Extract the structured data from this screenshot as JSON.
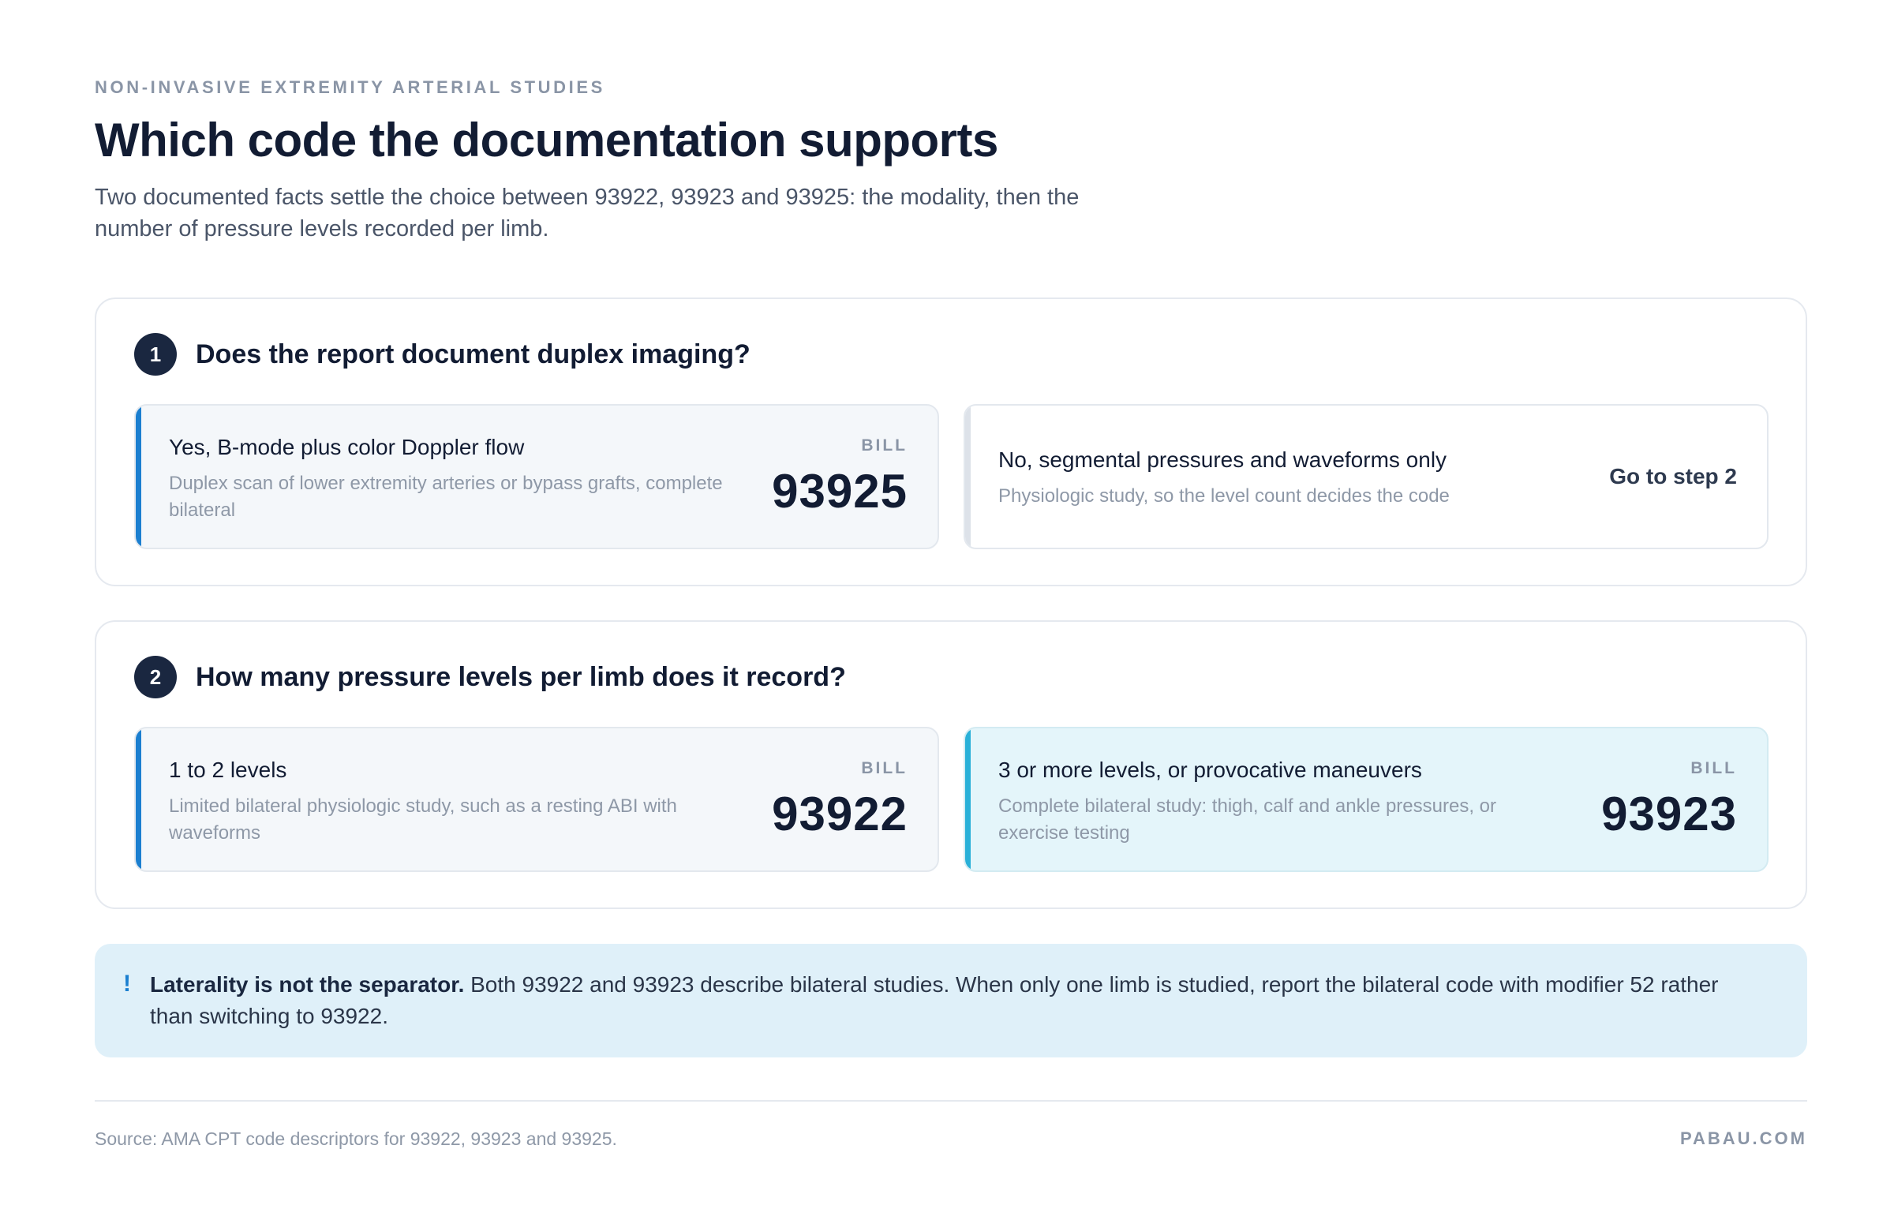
{
  "header": {
    "eyebrow": "NON-INVASIVE EXTREMITY ARTERIAL STUDIES",
    "title": "Which code the documentation supports",
    "subtitle": "Two documented facts settle the choice between 93922, 93923 and 93925: the modality, then the number of pressure levels recorded per limb."
  },
  "steps": [
    {
      "number": "1",
      "question": "Does the report document duplex imaging?",
      "options": [
        {
          "title": "Yes, B-mode plus color Doppler flow",
          "description": "Duplex scan of lower extremity arteries or bypass grafts, complete bilateral",
          "bill_label": "BILL",
          "code": "93925"
        },
        {
          "title": "No, segmental pressures and waveforms only",
          "description": "Physiologic study, so the level count decides the code",
          "action": "Go to step 2"
        }
      ]
    },
    {
      "number": "2",
      "question": "How many pressure levels per limb does it record?",
      "options": [
        {
          "title": "1 to 2 levels",
          "description": "Limited bilateral physiologic study, such as a resting ABI with waveforms",
          "bill_label": "BILL",
          "code": "93922"
        },
        {
          "title": "3 or more levels, or provocative maneuvers",
          "description": "Complete bilateral study: thigh, calf and ankle pressures, or exercise testing",
          "bill_label": "BILL",
          "code": "93923"
        }
      ]
    }
  ],
  "callout": {
    "mark": "!",
    "lead": "Laterality is not the separator.",
    "body": "Both 93922 and 93923 describe bilateral studies. When only one limb is studied, report the bilateral code with modifier 52 rather than switching to 93922."
  },
  "footer": {
    "source": "Source: AMA CPT code descriptors for 93922, 93923 and 93925.",
    "brand": "PABAU.COM"
  },
  "colors": {
    "accent_blue": "#1b7fd0",
    "accent_cyan": "#29b0d8",
    "step_badge": "#1a2740",
    "callout_bg": "#dff0f9"
  }
}
